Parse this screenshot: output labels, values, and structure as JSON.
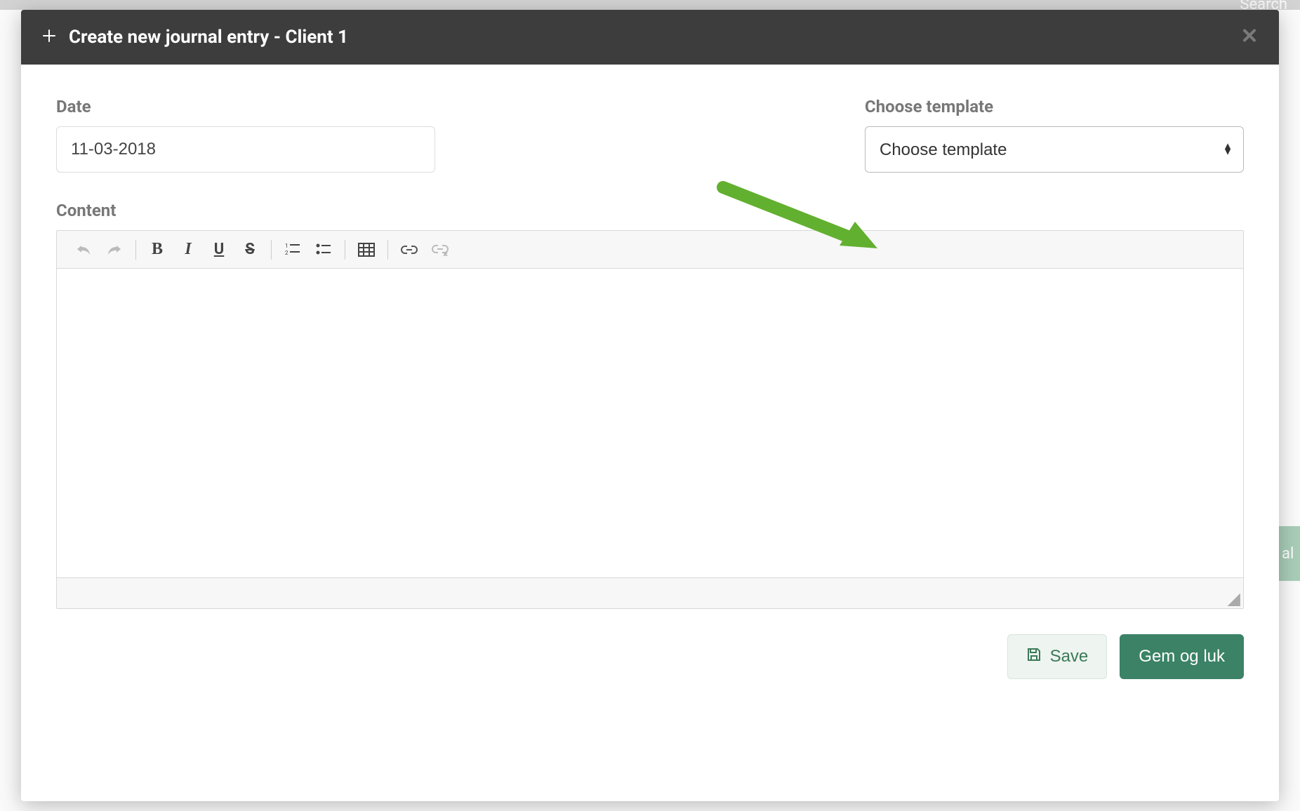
{
  "backdrop": {
    "search_text": "Search",
    "side_text": "al"
  },
  "modal": {
    "title": "Create new journal entry - Client 1"
  },
  "form": {
    "date_label": "Date",
    "date_value": "11-03-2018",
    "template_label": "Choose template",
    "template_selected": "Choose template",
    "content_label": "Content"
  },
  "editor": {
    "content": ""
  },
  "actions": {
    "save_label": "Save",
    "save_close_label": "Gem og luk"
  }
}
